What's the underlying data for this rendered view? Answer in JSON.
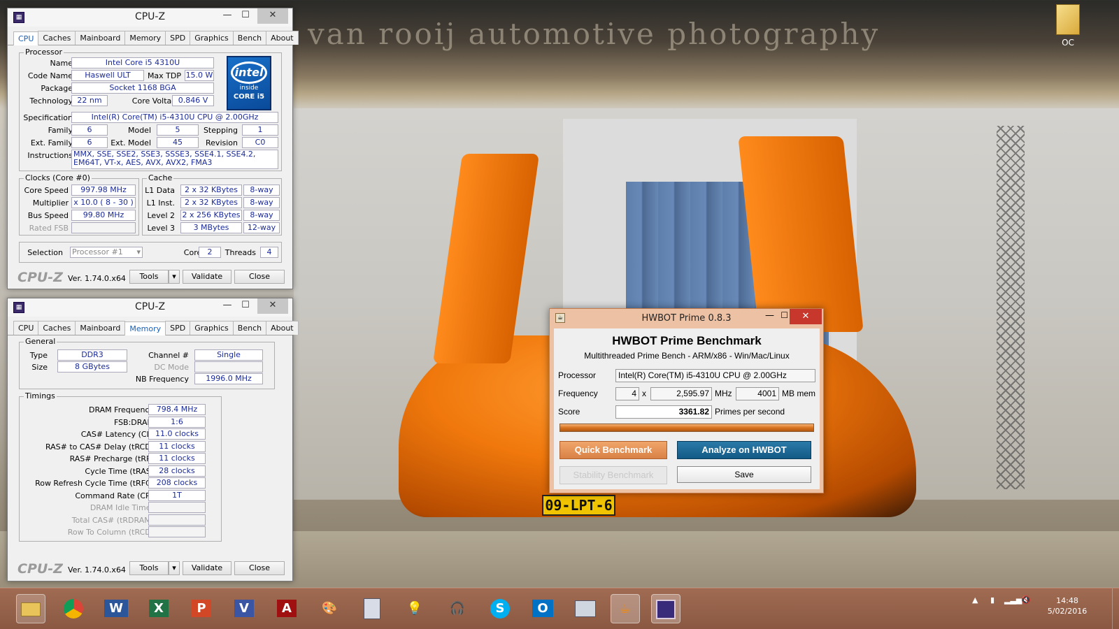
{
  "desktop": {
    "watermark": "van rooij automotive photography",
    "plate": "09-LPT-6",
    "icon_label": "OC"
  },
  "cpuz1": {
    "title": "CPU-Z",
    "tabs": [
      "CPU",
      "Caches",
      "Mainboard",
      "Memory",
      "SPD",
      "Graphics",
      "Bench",
      "About"
    ],
    "processor_legend": "Processor",
    "name_label": "Name",
    "name": "Intel Core i5 4310U",
    "codename_label": "Code Name",
    "codename": "Haswell ULT",
    "maxtdp_label": "Max TDP",
    "maxtdp": "15.0 W",
    "package_label": "Package",
    "package": "Socket 1168 BGA",
    "tech_label": "Technology",
    "tech": "22 nm",
    "voltage_label": "Core Voltage",
    "voltage": "0.846 V",
    "spec_label": "Specification",
    "spec": "Intel(R) Core(TM) i5-4310U CPU @ 2.00GHz",
    "family_label": "Family",
    "family": "6",
    "model_label": "Model",
    "model": "5",
    "stepping_label": "Stepping",
    "stepping": "1",
    "extfamily_label": "Ext. Family",
    "extfamily": "6",
    "extmodel_label": "Ext. Model",
    "extmodel": "45",
    "revision_label": "Revision",
    "revision": "C0",
    "instr_label": "Instructions",
    "instr": "MMX, SSE, SSE2, SSE3, SSSE3, SSE4.1, SSE4.2, EM64T, VT-x, AES, AVX, AVX2, FMA3",
    "intel_logo": "intel",
    "intel_inside": "inside",
    "intel_core": "CORE i5",
    "clocks_legend": "Clocks (Core #0)",
    "corespeed_label": "Core Speed",
    "corespeed": "997.98 MHz",
    "mult_label": "Multiplier",
    "mult": "x 10.0 ( 8 - 30 )",
    "bus_label": "Bus Speed",
    "bus": "99.80 MHz",
    "fsb_label": "Rated FSB",
    "cache_legend": "Cache",
    "l1d_label": "L1 Data",
    "l1d": "2 x 32 KBytes",
    "l1d_way": "8-way",
    "l1i_label": "L1 Inst.",
    "l1i": "2 x 32 KBytes",
    "l1i_way": "8-way",
    "l2_label": "Level 2",
    "l2": "2 x 256 KBytes",
    "l2_way": "8-way",
    "l3_label": "Level 3",
    "l3": "3 MBytes",
    "l3_way": "12-way",
    "selection_label": "Selection",
    "selection": "Processor #1",
    "cores_label": "Cores",
    "cores": "2",
    "threads_label": "Threads",
    "threads": "4",
    "logo": "CPU-Z",
    "version": "Ver. 1.74.0.x64",
    "tools": "Tools",
    "validate": "Validate",
    "close": "Close"
  },
  "cpuz2": {
    "title": "CPU-Z",
    "tabs": [
      "CPU",
      "Caches",
      "Mainboard",
      "Memory",
      "SPD",
      "Graphics",
      "Bench",
      "About"
    ],
    "general_legend": "General",
    "type_label": "Type",
    "type": "DDR3",
    "size_label": "Size",
    "size": "8 GBytes",
    "channel_label": "Channel #",
    "channel": "Single",
    "dcmode_label": "DC Mode",
    "nbfreq_label": "NB Frequency",
    "nbfreq": "1996.0 MHz",
    "timings_legend": "Timings",
    "timings": [
      {
        "label": "DRAM Frequency",
        "value": "798.4 MHz",
        "dim": false
      },
      {
        "label": "FSB:DRAM",
        "value": "1:6",
        "dim": false
      },
      {
        "label": "CAS# Latency (CL)",
        "value": "11.0 clocks",
        "dim": false
      },
      {
        "label": "RAS# to CAS# Delay (tRCD)",
        "value": "11 clocks",
        "dim": false
      },
      {
        "label": "RAS# Precharge (tRP)",
        "value": "11 clocks",
        "dim": false
      },
      {
        "label": "Cycle Time (tRAS)",
        "value": "28 clocks",
        "dim": false
      },
      {
        "label": "Row Refresh Cycle Time (tRFC)",
        "value": "208 clocks",
        "dim": false
      },
      {
        "label": "Command Rate (CR)",
        "value": "1T",
        "dim": false
      },
      {
        "label": "DRAM Idle Timer",
        "value": "",
        "dim": true
      },
      {
        "label": "Total CAS# (tRDRAM)",
        "value": "",
        "dim": true
      },
      {
        "label": "Row To Column (tRCD)",
        "value": "",
        "dim": true
      }
    ],
    "logo": "CPU-Z",
    "version": "Ver. 1.74.0.x64",
    "tools": "Tools",
    "validate": "Validate",
    "close": "Close"
  },
  "hwbot": {
    "title": "HWBOT Prime 0.8.3",
    "heading": "HWBOT Prime Benchmark",
    "subheading": "Multithreaded Prime Bench - ARM/x86 - Win/Mac/Linux",
    "processor_label": "Processor",
    "processor": "Intel(R) Core(TM) i5-4310U CPU @ 2.00GHz",
    "frequency_label": "Frequency",
    "threads": "4",
    "x": "x",
    "mhz": "2,595.97",
    "mhz_unit": "MHz",
    "mem": "4001",
    "mem_unit": "MB mem",
    "score_label": "Score",
    "score": "3361.82",
    "score_unit": "Primes per second",
    "progress": 1.0,
    "quick": "Quick Benchmark",
    "analyze": "Analyze on HWBOT",
    "stability": "Stability Benchmark",
    "save": "Save"
  },
  "taskbar": {
    "time": "14:48",
    "date": "5/02/2016"
  }
}
